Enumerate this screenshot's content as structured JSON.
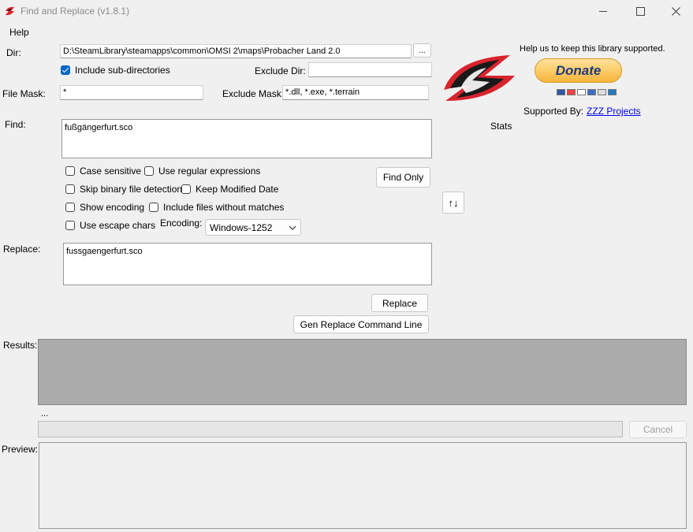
{
  "window": {
    "title": "Find and Replace (v1.8.1)"
  },
  "menu": {
    "help": "Help"
  },
  "dir": {
    "label": "Dir:",
    "value": "D:\\SteamLibrary\\steamapps\\common\\OMSI 2\\maps\\Probacher Land 2.0",
    "browse_label": "...",
    "include_subdirs_label": "Include sub-directories",
    "include_subdirs_checked": true,
    "exclude_dir_label": "Exclude Dir:",
    "exclude_dir_value": ""
  },
  "mask": {
    "file_mask_label": "File Mask:",
    "file_mask_value": "*",
    "exclude_mask_label": "Exclude Mask:",
    "exclude_mask_value": "*.dll, *.exe, *.terrain"
  },
  "find": {
    "label": "Find:",
    "value": "fußgängerfurt.sco"
  },
  "options": {
    "case_sensitive": "Case sensitive",
    "use_regex": "Use regular expressions",
    "skip_binary": "Skip binary file detection",
    "keep_modified": "Keep Modified Date",
    "show_encoding": "Show encoding",
    "include_no_matches": "Include files without matches",
    "use_escape": "Use escape chars",
    "encoding_label": "Encoding:",
    "encoding_value": "Windows-1252"
  },
  "buttons": {
    "find_only": "Find Only",
    "swap": "↑↓",
    "replace": "Replace",
    "gen_cmd": "Gen Replace Command Line",
    "cancel": "Cancel"
  },
  "replace": {
    "label": "Replace:",
    "value": "fussgaengerfurt.sco"
  },
  "support": {
    "help_text": "Help us to keep this library supported.",
    "donate_label": "Donate",
    "supported_by_label": "Supported By:",
    "supported_by_link": "ZZZ Projects",
    "stats_label": "Stats"
  },
  "results": {
    "label": "Results:",
    "status": "..."
  },
  "preview": {
    "label": "Preview:"
  },
  "colors": {
    "accent": "#0067c0",
    "logo_red": "#d9232d",
    "logo_dark": "#1a1a1a"
  }
}
